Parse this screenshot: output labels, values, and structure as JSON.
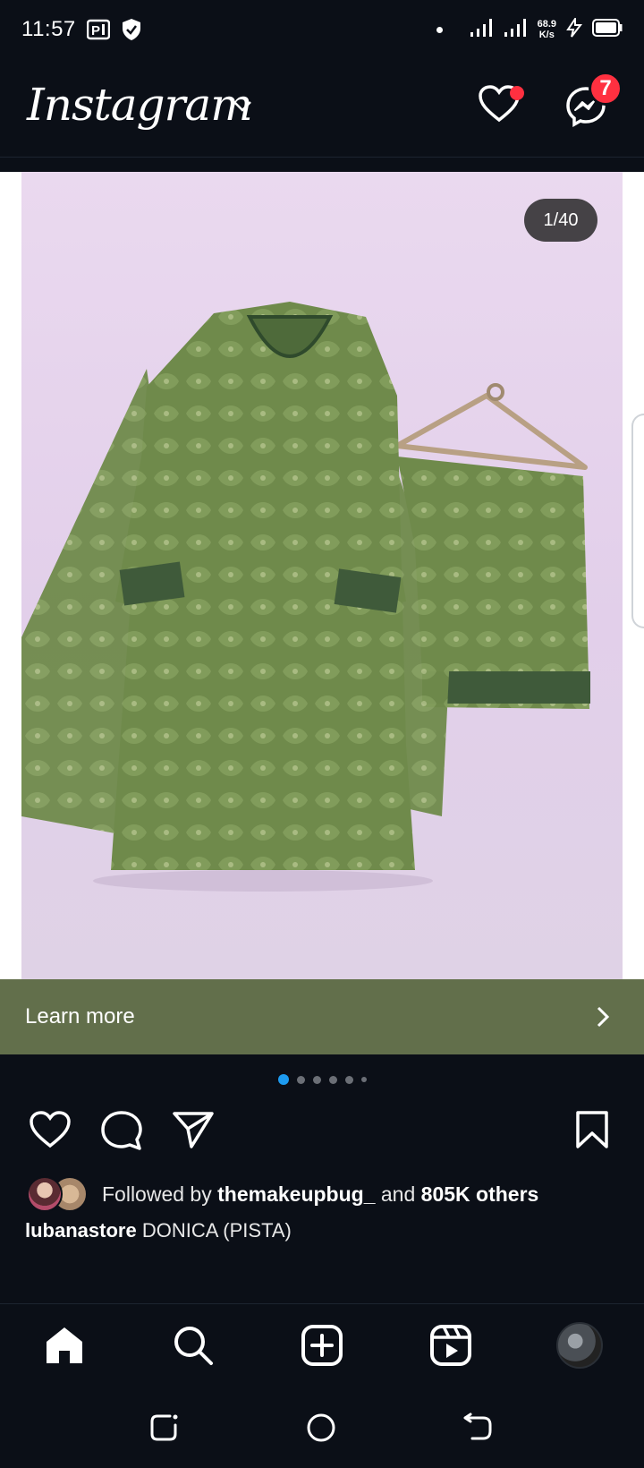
{
  "status_bar": {
    "time": "11:57",
    "net_speed_value": "68.9",
    "net_speed_unit": "K/s",
    "icons": [
      "p-notification-icon",
      "shield-icon",
      "signal-icon",
      "signal-icon",
      "charging-icon",
      "battery-icon"
    ]
  },
  "header": {
    "logo": "Instagram",
    "messages_badge": "7"
  },
  "post": {
    "image_counter": "1/40",
    "cta_label": "Learn more",
    "cta_color": "#626f4b",
    "carousel_dots_total": 6,
    "carousel_active_index": 0,
    "followed_prefix": "Followed by",
    "followed_user": "themakeupbug_",
    "followed_and": "and",
    "followed_count": "805K others",
    "caption_user": "lubanastore",
    "caption_text": "DONICA (PISTA)"
  },
  "colors": {
    "background": "#0b0f17",
    "badge": "#ff3040",
    "active_dot": "#1d9bf0"
  }
}
